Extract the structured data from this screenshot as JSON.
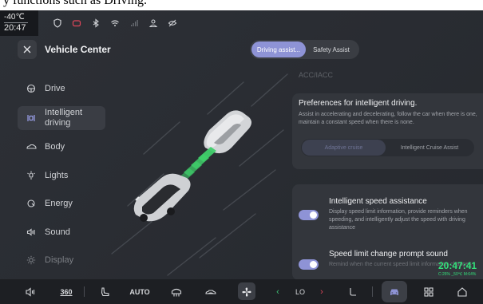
{
  "caption": "y functions such as Driving.",
  "status_bar": {
    "temperature": "-40℃",
    "time": "20:47",
    "icons": [
      "shield-icon",
      "battery-icon",
      "bluetooth-icon",
      "wifi-icon",
      "signal-icon",
      "person-icon",
      "eye-off-icon"
    ]
  },
  "header": {
    "title": "Vehicle Center",
    "tabs": [
      {
        "label": "Driving assist...",
        "active": true
      },
      {
        "label": "Safety Assist",
        "active": false
      }
    ]
  },
  "sidebar": {
    "items": [
      {
        "label": "Drive",
        "icon": "steering-wheel-icon",
        "active": false
      },
      {
        "label": "Intelligent driving",
        "line1": "Intelligent",
        "line2": "driving",
        "icon": "lane-assist-icon",
        "active": true
      },
      {
        "label": "Body",
        "icon": "car-body-icon",
        "active": false
      },
      {
        "label": "Lights",
        "icon": "light-icon",
        "active": false
      },
      {
        "label": "Energy",
        "icon": "energy-icon",
        "active": false
      },
      {
        "label": "Sound",
        "icon": "speaker-icon",
        "active": false
      },
      {
        "label": "Display",
        "icon": "brightness-icon",
        "active": false
      }
    ]
  },
  "right_panel": {
    "section_title": "ACC/IACC",
    "preferences": {
      "title": "Preferences for intelligent driving.",
      "description": "Assist in accelerating and decelerating, follow the car when there is one, maintain a constant speed when there is none.",
      "options": [
        {
          "label": "Adaptive cruise",
          "selected": true
        },
        {
          "label": "Intelligent Cruise Assist",
          "selected": false
        }
      ]
    },
    "settings": [
      {
        "title": "Intelligent speed assistance",
        "description": "Display speed limit information, provide reminders when speeding, and intelligently adjust the speed with driving assistance",
        "enabled": true
      },
      {
        "title": "Speed limit change prompt sound",
        "description": "Remind when the current speed limit information changes",
        "enabled": true
      }
    ]
  },
  "overlay_clock": {
    "time": "20:47:41",
    "info": "C:26% _50℃ M:64%"
  },
  "dock": {
    "items": [
      "speaker-icon",
      "360",
      "seat-icon",
      "AUTO",
      "rear-defrost-icon",
      "car-icon",
      "fan-icon",
      "LO",
      "seat-heat-icon",
      "car-settings-icon",
      "apps-icon",
      "home-icon"
    ],
    "label_360": "360",
    "label_auto": "AUTO",
    "temp_value": "LO",
    "accent": "#3fc276",
    "warn": "#e0465a"
  },
  "colors": {
    "accent": "#8e93d6",
    "clock_green": "#33e07a"
  }
}
